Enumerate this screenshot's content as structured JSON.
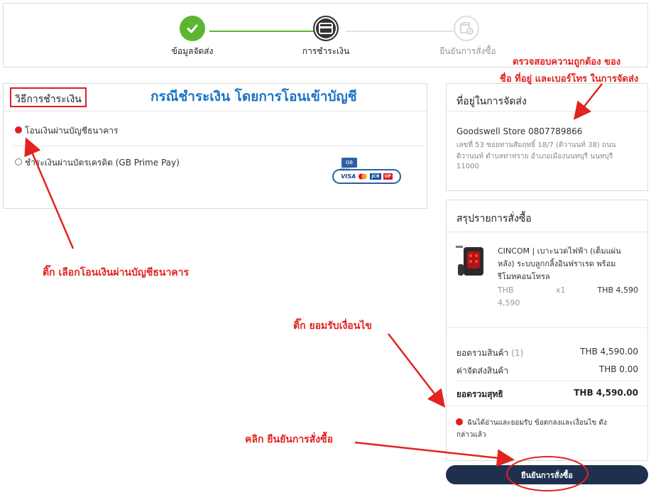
{
  "stepper": {
    "steps": [
      {
        "label": "ข้อมูลจัดส่ง",
        "state": "done"
      },
      {
        "label": "การชำระเงิน",
        "state": "current"
      },
      {
        "label": "ยืนยันการสั่งซื้อ",
        "state": "pending"
      }
    ]
  },
  "payment": {
    "title": "วิธีการชำระเงิน",
    "options": [
      {
        "label": "โอนเงินผ่านบัญชีธนาคาร",
        "selected": true
      },
      {
        "label": "ชำระเงินผ่านบัตรเครดิต (GB Prime Pay)",
        "selected": false
      }
    ],
    "card_badge": {
      "top": "GB",
      "sub": "PPAY",
      "brands": [
        "VISA",
        "MC",
        "JCB",
        "UP"
      ]
    }
  },
  "address": {
    "title": "ที่อยู่ในการจัดส่ง",
    "name_phone": "Goodswell Store 0807789866",
    "line1": "เลขที่ 53 ซอยทานสัมฤทธิ์ 18/7 (ติวานนท์ 38) ถนน",
    "line2": "ติวานนท์ ตำบลท่าทราย อำเภอเมืองนนทบุรี นนทบุรี",
    "line3": "11000"
  },
  "summary": {
    "title": "สรุปรายการสั่งซื้อ",
    "item": {
      "name_line1": "CINCOM | เบาะนวดไฟฟ้า (เต็มแผ่น",
      "name_line2": "หลัง) ระบบลูกกลิ้งอินฟราเรด พร้อม",
      "name_line3": "รีโมทคอนโทรล",
      "unit_price_line1": "THB",
      "unit_price_line2": "4,590",
      "qty": "x1",
      "total": "THB 4,590"
    },
    "subtotal_label": "ยอดรวมสินค้า",
    "subtotal_count": "(1)",
    "subtotal_value": "THB 4,590.00",
    "shipping_label": "ค่าจัดส่งสินค้า",
    "shipping_value": "THB 0.00",
    "net_label": "ยอดรวมสุทธิ",
    "net_value": "THB 4,590.00",
    "terms_line1": "ฉันได้อ่านและยอมรับ ข้อตกลงและเงื่อนไข ดัง",
    "terms_line2": "กล่าวแล้ว",
    "terms_checked": true
  },
  "confirm_button": "ยืนยันการสั่งซื้อ",
  "annotations": {
    "heading": "กรณีชำระเงิน โดยการโอนเข้าบัญชี",
    "check_address_1": "ตรวจสอบความถูกต้อง ของ",
    "check_address_2": "ชื่อ ที่อยู่ และเบอร์โทร ในการจัดส่ง",
    "tick_bank": "ติ๊ก เลือกโอนเงินผ่านบัญชีธนาคาร",
    "tick_terms": "ติ๊ก ยอมรับเงื่อนไข",
    "click_confirm": "คลิก ยืนยันการสั่งซื้อ"
  },
  "colors": {
    "done": "#5cb531",
    "current": "#333333",
    "pending": "#dddddd",
    "annotation": "#e3231f",
    "heading": "#1a74c4",
    "button": "#1f2f4e",
    "radio_selected": "#e01e1e"
  }
}
